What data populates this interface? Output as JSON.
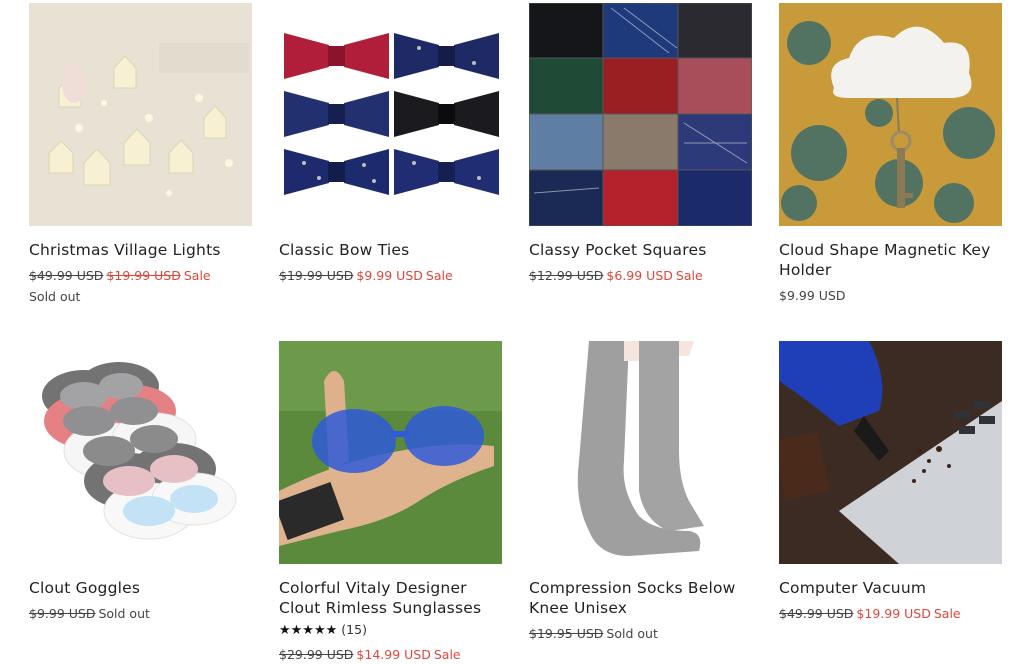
{
  "products": [
    {
      "title": "Christmas Village Lights",
      "compare_price": "$49.99 USD",
      "price": "$19.99 USD",
      "sale_label": "Sale",
      "sold_out": "Sold out"
    },
    {
      "title": "Classic Bow Ties",
      "compare_price": "$19.99 USD",
      "price": "$9.99 USD",
      "sale_label": "Sale"
    },
    {
      "title": "Classy Pocket Squares",
      "compare_price": "$12.99 USD",
      "price": "$6.99 USD",
      "sale_label": "Sale"
    },
    {
      "title": "Cloud Shape Magnetic Key Holder",
      "price": "$9.99 USD"
    },
    {
      "title": "Clout Goggles",
      "compare_price": "$9.99 USD",
      "sold_out": "Sold out"
    },
    {
      "title": "Colorful Vitaly Designer Clout Rimless Sunglasses",
      "rating_stars": "★★★★★",
      "review_count": "(15)",
      "compare_price": "$29.99 USD",
      "price": "$14.99 USD",
      "sale_label": "Sale"
    },
    {
      "title": "Compression Socks Below Knee Unisex",
      "compare_price": "$19.95 USD",
      "sold_out": "Sold out"
    },
    {
      "title": "Computer Vacuum",
      "compare_price": "$49.99 USD",
      "price": "$19.99 USD",
      "sale_label": "Sale"
    }
  ],
  "colors": {
    "sale_red": "#e0463b",
    "text_dark": "#222222",
    "text_muted": "#444444"
  },
  "icons": {
    "rating": "star-icon"
  }
}
